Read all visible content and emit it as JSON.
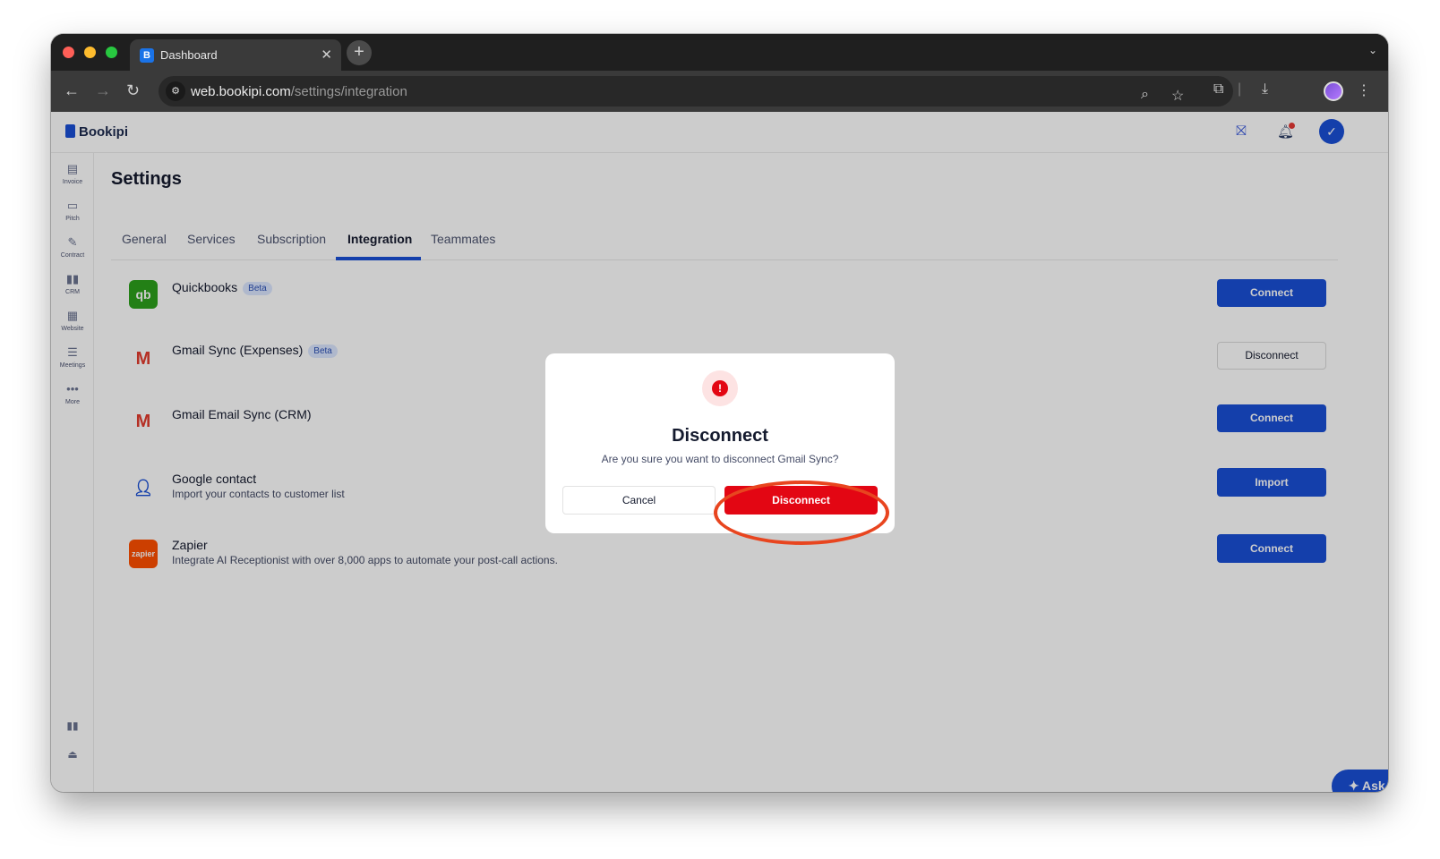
{
  "browser": {
    "tab_title": "Dashboard",
    "url_host": "web.bookipi.com",
    "url_path": "/settings/integration"
  },
  "app": {
    "logo": "Bookipi",
    "sidebar": [
      {
        "label": "Invoice",
        "icon": "invoice-icon"
      },
      {
        "label": "Pitch",
        "icon": "pitch-icon"
      },
      {
        "label": "Contract",
        "icon": "contract-icon"
      },
      {
        "label": "CRM",
        "icon": "crm-icon"
      },
      {
        "label": "Website",
        "icon": "website-icon"
      },
      {
        "label": "Meetings",
        "icon": "meetings-icon"
      },
      {
        "label": "More",
        "icon": "more-icon"
      }
    ]
  },
  "settings": {
    "title": "Settings",
    "tabs": [
      "General",
      "Services",
      "Subscription",
      "Integration",
      "Teammates"
    ],
    "active_tab": "Integration",
    "integrations": [
      {
        "name": "Quickbooks",
        "badge": "Beta",
        "description": "",
        "action": "Connect"
      },
      {
        "name": "Gmail Sync (Expenses)",
        "badge": "Beta",
        "description": "",
        "action": "Disconnect"
      },
      {
        "name": "Gmail Email Sync (CRM)",
        "badge": "",
        "description": "",
        "action": "Connect"
      },
      {
        "name": "Google contact",
        "badge": "",
        "description": "Import your contacts to customer list",
        "action": "Import"
      },
      {
        "name": "Zapier",
        "badge": "",
        "description": "Integrate AI Receptionist with over 8,000 apps to automate your post-call actions.",
        "action": "Connect"
      }
    ],
    "ask_ai": "Ask AI"
  },
  "modal": {
    "title": "Disconnect",
    "message": "Are you sure you want to disconnect Gmail Sync?",
    "cancel": "Cancel",
    "confirm": "Disconnect"
  },
  "colors": {
    "primary": "#1a4fd6",
    "danger": "#e30613",
    "highlight": "#e8451f"
  }
}
